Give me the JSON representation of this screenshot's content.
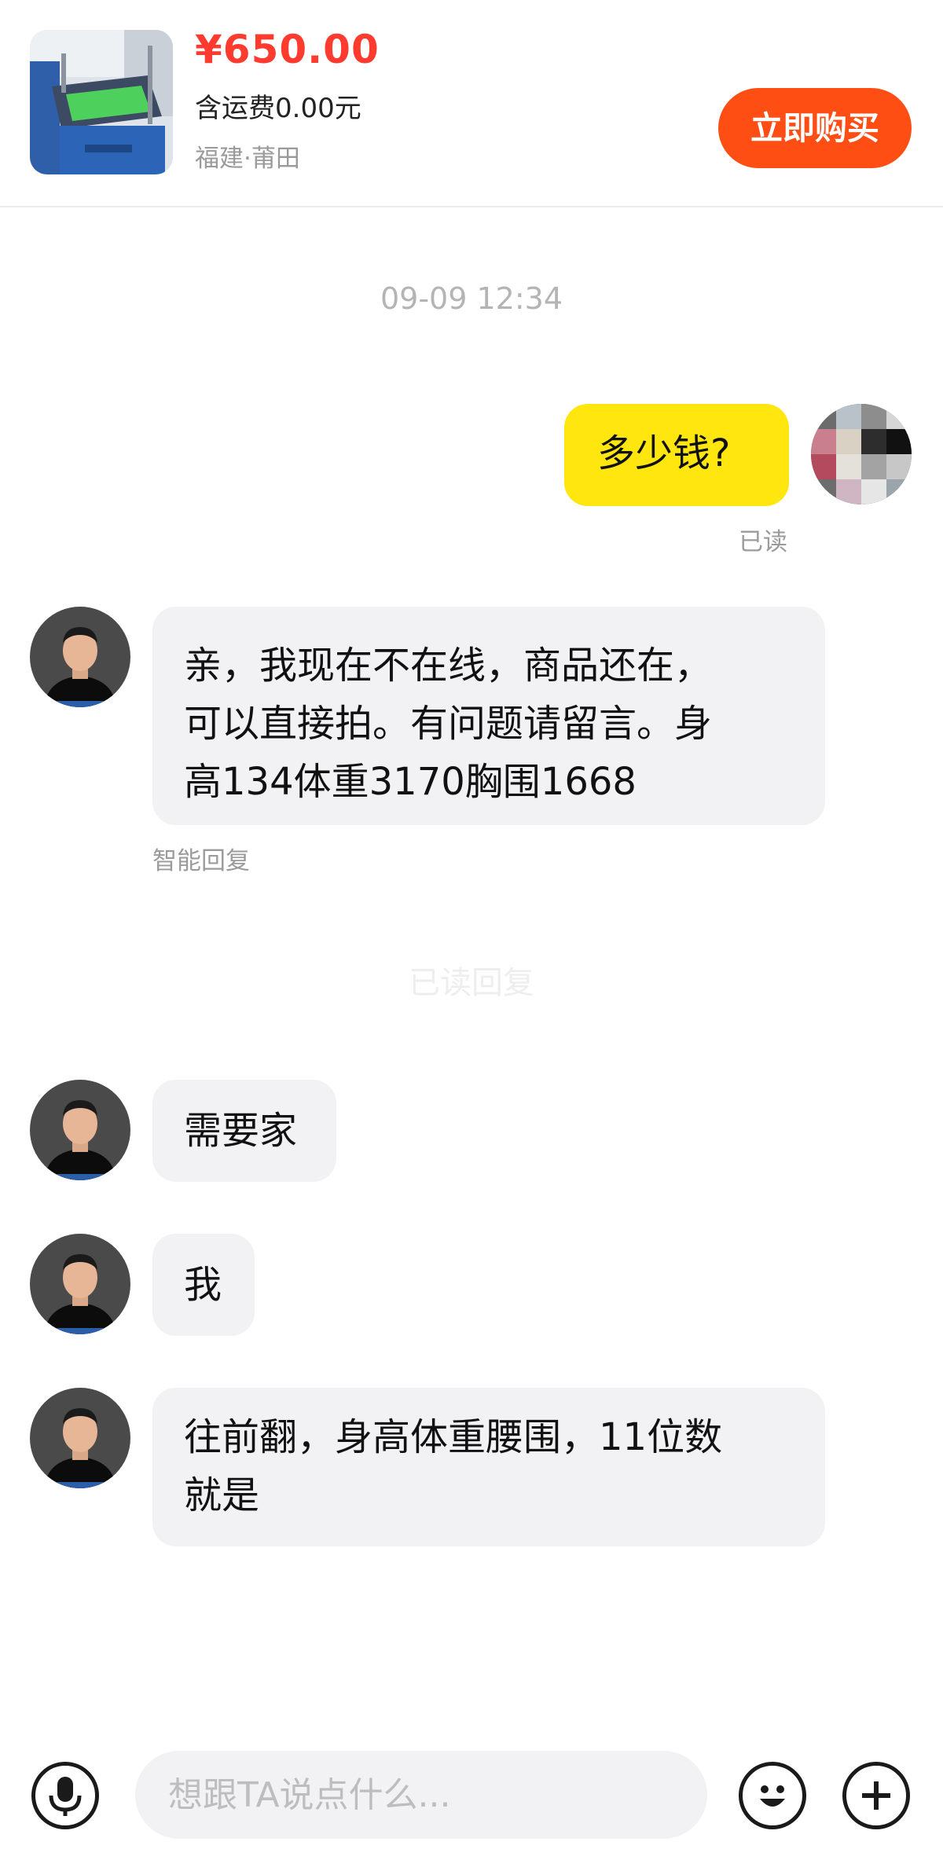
{
  "product": {
    "price": "¥650.00",
    "shipping": "含运费0.00元",
    "location": "福建·莆田",
    "buy_label": "立即购买",
    "image_icon": "screen-printing-table-photo"
  },
  "chat": {
    "timestamp": "09-09 12:34",
    "outgoing": {
      "text": "多少钱?",
      "status": "已读"
    },
    "auto_reply": {
      "lines": [
        "亲，我现在不在线，商品还在，",
        "可以直接拍。有问题请留言。身",
        "高134体重3170胸围1668"
      ],
      "tag": "智能回复"
    },
    "faded_text": "已读回复",
    "messages": [
      {
        "lines": [
          "需要家"
        ]
      },
      {
        "lines": [
          "我"
        ]
      },
      {
        "lines": [
          "往前翻，身高体重腰围，11位数",
          "就是"
        ]
      }
    ]
  },
  "input_bar": {
    "placeholder": "想跟TA说点什么...",
    "voice_icon": "microphone-icon",
    "emoji_icon": "emoji-smile-icon",
    "more_icon": "plus-icon"
  },
  "colors": {
    "price": "#ff3b2f",
    "buy_button": "#ff4e14",
    "own_bubble": "#ffe60f",
    "other_bubble": "#f2f2f4"
  }
}
